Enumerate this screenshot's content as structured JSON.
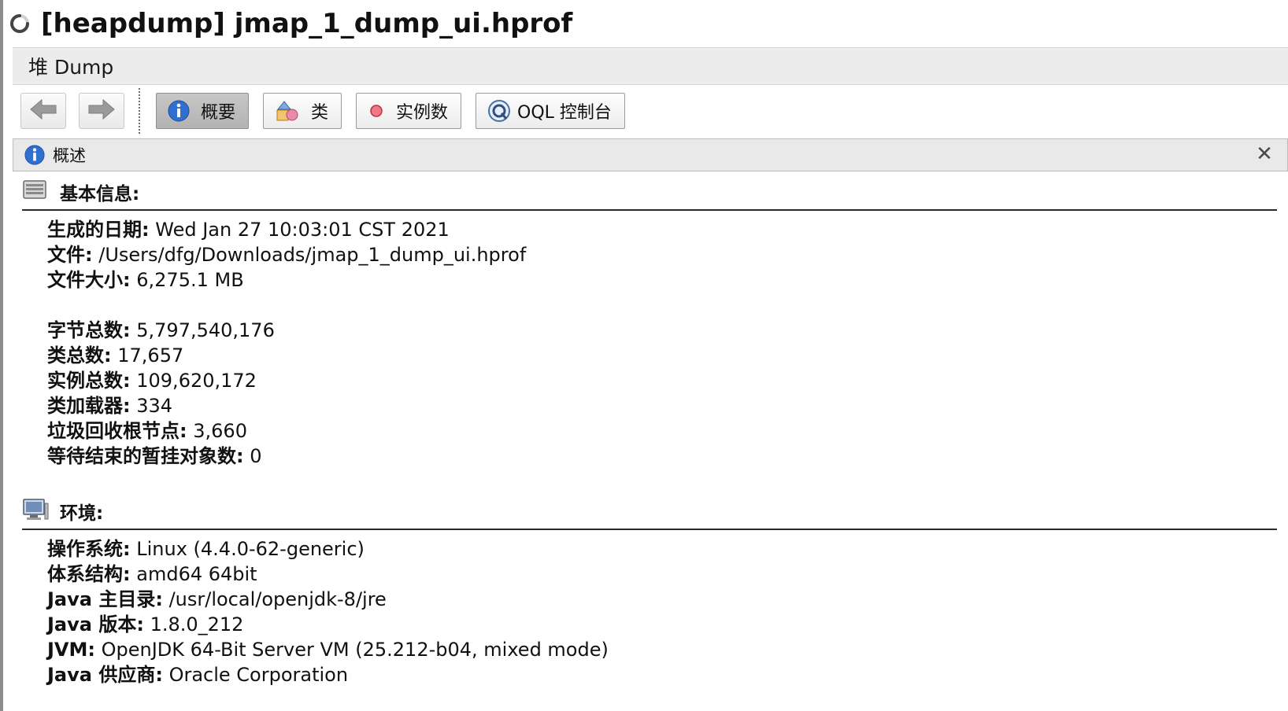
{
  "window": {
    "title": "[heapdump] jmap_1_dump_ui.hprof"
  },
  "tab": {
    "label": "堆 Dump"
  },
  "toolbar": {
    "back_icon": "arrow-left-icon",
    "forward_icon": "arrow-right-icon",
    "summary_label": "概要",
    "classes_label": "类",
    "instances_label": "实例数",
    "oql_label": "OQL 控制台"
  },
  "panel": {
    "title": "概述",
    "close_glyph": "✕"
  },
  "basic_info": {
    "title": "基本信息:",
    "rows": [
      {
        "label": "生成的日期:",
        "value": "Wed Jan 27 10:03:01 CST 2021"
      },
      {
        "label": "文件:",
        "value": "/Users/dfg/Downloads/jmap_1_dump_ui.hprof"
      },
      {
        "label": "文件大小:",
        "value": "6,275.1 MB"
      },
      {
        "label": "字节总数:",
        "value": "5,797,540,176"
      },
      {
        "label": "类总数:",
        "value": "17,657"
      },
      {
        "label": "实例总数:",
        "value": "109,620,172"
      },
      {
        "label": "类加载器:",
        "value": "334"
      },
      {
        "label": "垃圾回收根节点:",
        "value": "3,660"
      },
      {
        "label": "等待结束的暂挂对象数:",
        "value": "0"
      }
    ]
  },
  "environment": {
    "title": "环境:",
    "rows": [
      {
        "label": "操作系统:",
        "value": "Linux (4.4.0-62-generic)"
      },
      {
        "label": "体系结构:",
        "value": "amd64 64bit"
      },
      {
        "label": "Java 主目录:",
        "value": "/usr/local/openjdk-8/jre"
      },
      {
        "label": "Java 版本:",
        "value": "1.8.0_212"
      },
      {
        "label": "JVM:",
        "value": "OpenJDK 64-Bit Server VM (25.212-b04, mixed mode)"
      },
      {
        "label": "Java 供应商:",
        "value": "Oracle Corporation"
      }
    ]
  },
  "colors": {
    "accent_blue": "#2f6fd0",
    "toolbar_active": "#bdbdbd"
  }
}
